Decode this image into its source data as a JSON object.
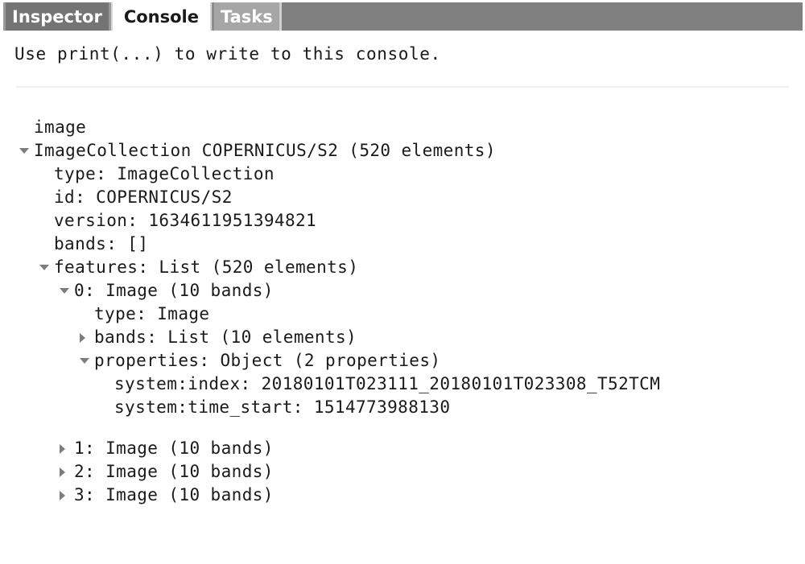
{
  "tabs": [
    {
      "label": "Inspector",
      "state": "inactive",
      "name": "tab-inspector"
    },
    {
      "label": "Console",
      "state": "active",
      "name": "tab-console"
    },
    {
      "label": "Tasks",
      "state": "inactive",
      "name": "tab-tasks"
    }
  ],
  "console": {
    "hint": "Use print(...) to write to this console.",
    "output_label": "image"
  },
  "tree": [
    {
      "indent": 0,
      "toggle": "down",
      "text": "ImageCollection COPERNICUS/S2 (520 elements)"
    },
    {
      "indent": 1,
      "toggle": "none",
      "text": "type: ImageCollection"
    },
    {
      "indent": 1,
      "toggle": "none",
      "text": "id: COPERNICUS/S2"
    },
    {
      "indent": 1,
      "toggle": "none",
      "text": "version: 1634611951394821"
    },
    {
      "indent": 1,
      "toggle": "none",
      "text": "bands: []"
    },
    {
      "indent": 1,
      "toggle": "down",
      "text": "features: List (520 elements)"
    },
    {
      "indent": 2,
      "toggle": "down",
      "text": "0: Image (10 bands)"
    },
    {
      "indent": 3,
      "toggle": "none",
      "text": "type: Image"
    },
    {
      "indent": 3,
      "toggle": "right",
      "text": "bands: List (10 elements)"
    },
    {
      "indent": 3,
      "toggle": "down",
      "text": "properties: Object (2 properties)"
    },
    {
      "indent": 4,
      "toggle": "none",
      "text": "system:index: 20180101T023111_20180101T023308_T52TCM"
    },
    {
      "indent": 4,
      "toggle": "none",
      "text": "system:time_start: 1514773988130"
    },
    {
      "indent": -1,
      "toggle": "none",
      "text": ""
    },
    {
      "indent": 2,
      "toggle": "right",
      "text": "1: Image (10 bands)"
    },
    {
      "indent": 2,
      "toggle": "right",
      "text": "2: Image (10 bands)"
    },
    {
      "indent": 2,
      "toggle": "right",
      "text": "3: Image (10 bands)"
    }
  ],
  "colors": {
    "tabbar_background": "#808080",
    "tab_inactive_inspector": "#747474",
    "tab_inactive_tasks": "#a6a6a6",
    "tab_active": "#ffffff",
    "text": "#1a1a1a",
    "toggle": "#7d7d7d",
    "divider": "#eeeeee"
  }
}
